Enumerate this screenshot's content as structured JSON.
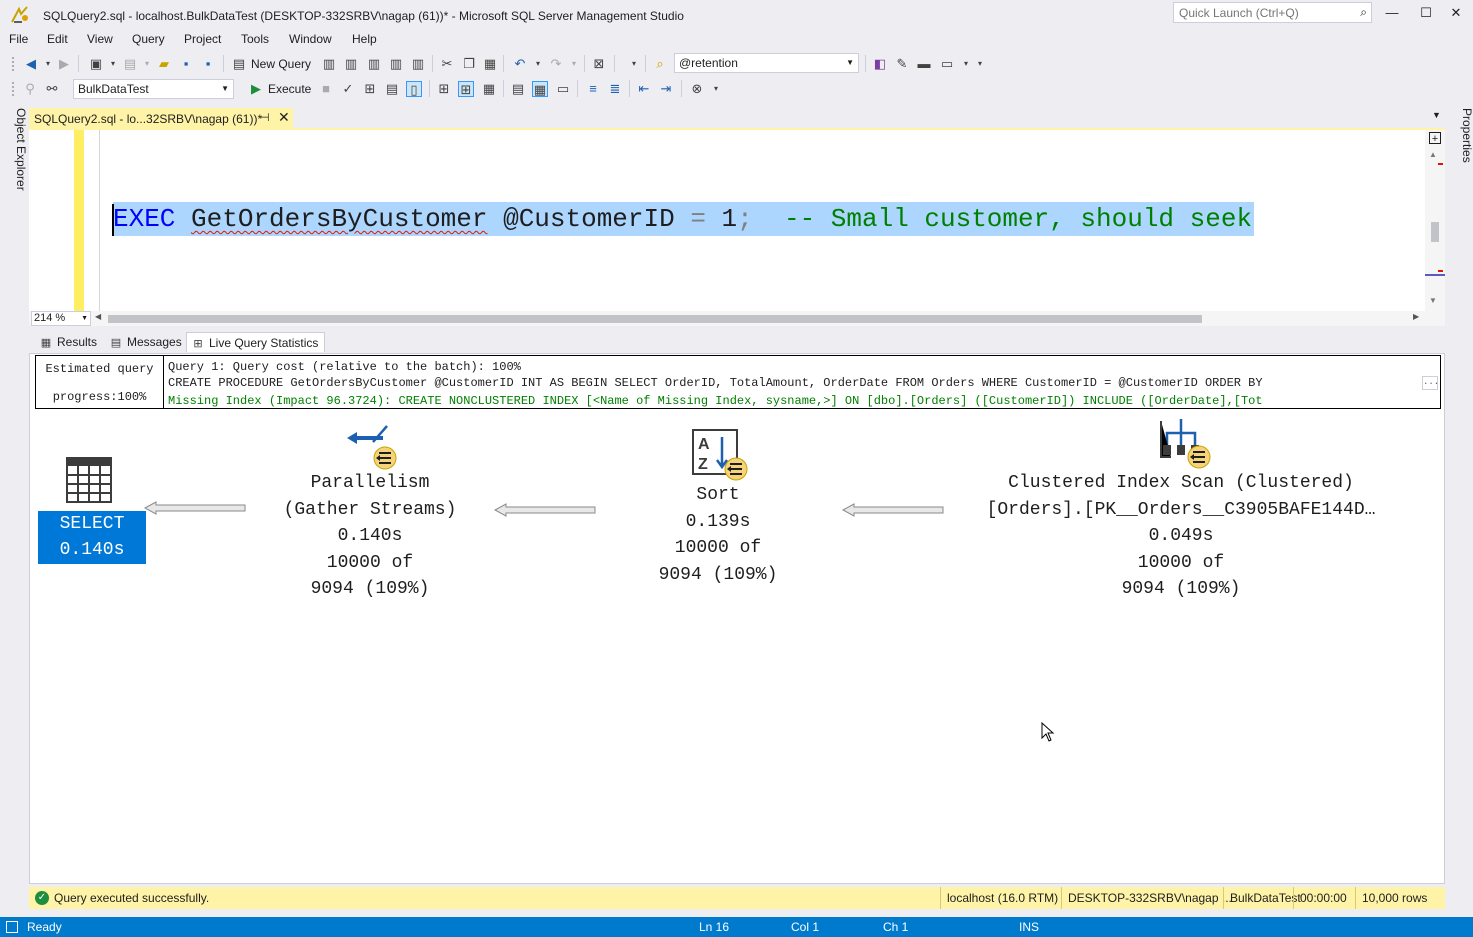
{
  "window": {
    "title": "SQLQuery2.sql - localhost.BulkDataTest (DESKTOP-332SRBV\\nagap (61))* - Microsoft SQL Server Management Studio",
    "quick_launch_placeholder": "Quick Launch (Ctrl+Q)",
    "minimize": "—",
    "maximize": "☐",
    "close": "✕"
  },
  "menu": [
    "File",
    "Edit",
    "View",
    "Query",
    "Project",
    "Tools",
    "Window",
    "Help"
  ],
  "toolbar1": {
    "new_query_label": "New Query",
    "search_combo_value": "@retention"
  },
  "toolbar2": {
    "database_combo_value": "BulkDataTest",
    "execute_label": "Execute"
  },
  "side": {
    "object_explorer": "Object Explorer",
    "properties": "Properties"
  },
  "doc_tab": {
    "label": "SQLQuery2.sql - lo...32SRBV\\nagap (61))*",
    "pin": "⊣",
    "close": "✕"
  },
  "editor": {
    "code": {
      "exec": "EXEC",
      "proc": "GetOrdersByCustomer",
      "param": " @CustomerID ",
      "eq": "=",
      "value": " 1",
      "semi": ";",
      "comment": "  -- Small customer, should seek"
    },
    "zoom": "214 %"
  },
  "result_tabs": {
    "results": "Results",
    "messages": "Messages",
    "live_query_statistics": "Live Query Statistics"
  },
  "plan": {
    "progress_line1": "Estimated query",
    "progress_line2": "progress:100%",
    "header_line1": "Query 1: Query cost (relative to the batch): 100%",
    "header_line2": "CREATE PROCEDURE GetOrdersByCustomer @CustomerID INT AS BEGIN SELECT OrderID, TotalAmount, OrderDate FROM Orders WHERE CustomerID = @CustomerID ORDER BY",
    "header_line3": "Missing Index (Impact 96.3724): CREATE NONCLUSTERED INDEX [<Name of Missing Index, sysname,>] ON [dbo].[Orders] ([CustomerID]) INCLUDE ([OrderDate],[Tot",
    "header_ellipsis": "...",
    "nodes": {
      "select": {
        "line1": "SELECT",
        "line2": "0.140s"
      },
      "parallelism": {
        "line1": "Parallelism",
        "line2": "(Gather Streams)",
        "line3": "0.140s",
        "line4": "10000 of",
        "line5": "9094 (109%)"
      },
      "sort": {
        "line1": "Sort",
        "line2": "0.139s",
        "line3": "10000 of",
        "line4": "9094 (109%)"
      },
      "scan": {
        "line1": "Clustered Index Scan (Clustered)",
        "line2": "[Orders].[PK__Orders__C3905BAFE144D…",
        "line3": "0.049s",
        "line4": "10000 of",
        "line5": "9094 (109%)"
      }
    }
  },
  "query_status": {
    "message": "Query executed successfully.",
    "server": "localhost (16.0 RTM)",
    "user": "DESKTOP-332SRBV\\nagap ...",
    "database": "BulkDataTest",
    "elapsed": "00:00:00",
    "rows": "10,000 rows"
  },
  "statusbar": {
    "ready": "Ready",
    "ln": "Ln 16",
    "col": "Col 1",
    "ch": "Ch 1",
    "ins": "INS"
  },
  "colors": {
    "accent_blue": "#007acc",
    "doc_tab_yellow": "#fff3a8",
    "selection": "#add6ff",
    "select_node": "#0078d7",
    "keyword": "#0000ff",
    "comment": "#008000"
  }
}
